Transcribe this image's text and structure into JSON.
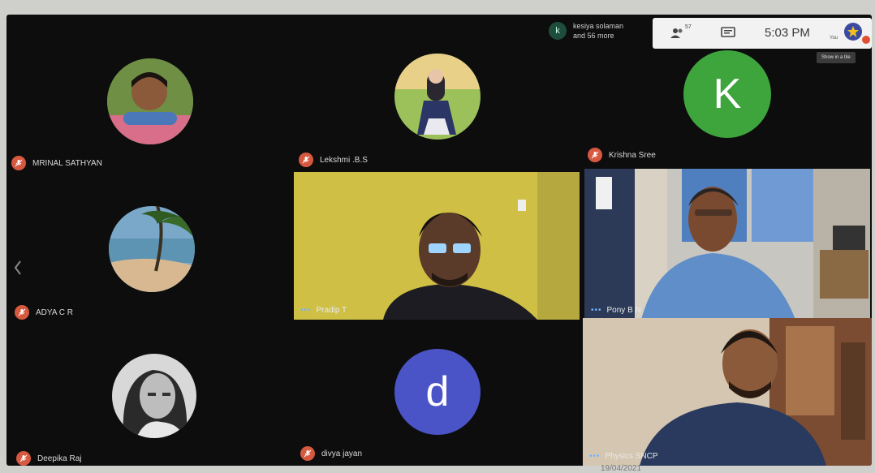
{
  "meeting": {
    "time": "5:03 PM",
    "participants_badge": "57",
    "you_label": "You",
    "tooltip": "Show in a tile"
  },
  "join_notice": {
    "avatar_letter": "k",
    "line1": "kesiya solaman",
    "line2": "and 56 more"
  },
  "participants": [
    {
      "name": "MRINAL SATHYAN",
      "type": "photo"
    },
    {
      "name": "Lekshmi .B.S",
      "type": "photo"
    },
    {
      "name": "Krishna Sree",
      "type": "letter",
      "letter": "K",
      "color": "#3ea43c"
    },
    {
      "name": "ADYA C R",
      "type": "photo"
    },
    {
      "name": "Pradip T",
      "type": "video"
    },
    {
      "name": "Pony B N",
      "type": "video"
    },
    {
      "name": "Deepika Raj",
      "type": "photo"
    },
    {
      "name": "divya jayan",
      "type": "letter",
      "letter": "d",
      "color": "#4b54c6"
    },
    {
      "name": "Physics SNCP",
      "type": "video"
    }
  ],
  "colors": {
    "mic_muted": "#d6593f",
    "screen_bg": "#0d0d0e"
  },
  "footer_text": "19/04/2021"
}
